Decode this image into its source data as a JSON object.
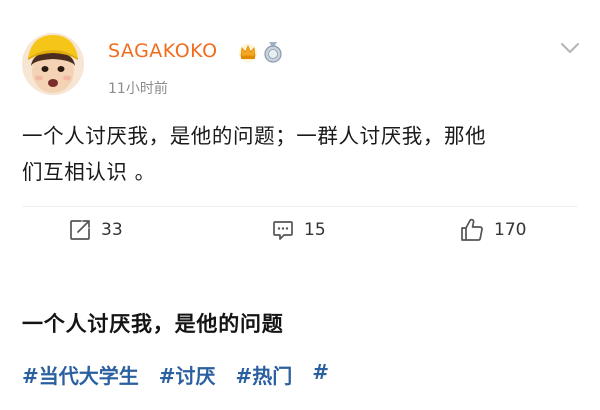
{
  "post": {
    "username": "SAGAKOKO",
    "time": "11小时前",
    "text_line1": "一个人讨厌我，是他的问题；一群人讨厌我，那他",
    "text_line2": "们互相认识 。"
  },
  "actions": {
    "repost_count": "33",
    "comment_count": "15",
    "like_count": "170"
  },
  "summary": {
    "title": "一个人讨厌我，是他的问题",
    "hashtags": [
      "#当代大学生",
      "#讨厌",
      "#热门",
      "#"
    ]
  },
  "colors": {
    "username": "#f06d1e",
    "hashtag": "#2a5fa0",
    "meta": "#8c8c8c"
  },
  "icons": {
    "avatar": "child-avatar-yellow-hat",
    "crown": "crown-icon",
    "medal": "medal-icon",
    "more": "chevron-down-icon",
    "repost": "repost-icon",
    "comment": "comment-icon",
    "like": "thumbs-up-icon"
  }
}
